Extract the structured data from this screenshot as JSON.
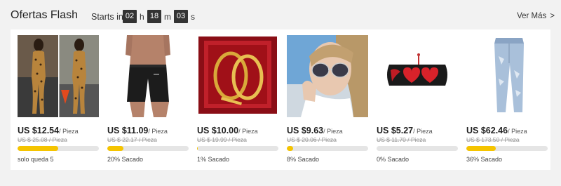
{
  "header": {
    "title": "Ofertas Flash",
    "starts_label": "Starts in",
    "hours": "02",
    "hours_unit": "h",
    "minutes": "18",
    "minutes_unit": "m",
    "seconds": "03",
    "seconds_unit": "s",
    "view_all_label": "Ver Más",
    "chevron": ">"
  },
  "colors": {
    "accent_bar": "#f5c400",
    "bar_track": "#e5e5e5",
    "timer_bg": "#333333"
  },
  "products": [
    {
      "image": "leopard-jumpsuit-image",
      "price": "US $12.54",
      "per_unit": "/ Pieza",
      "old_price": "US $ 25.08 / Pieza",
      "sold_fraction": 0.5,
      "status": "solo queda 5"
    },
    {
      "image": "black-shorts-image",
      "price": "US $11.09",
      "per_unit": "/ Pieza",
      "old_price": "US $ 22.17 / Pieza",
      "sold_fraction": 0.2,
      "status": "20% Sacado"
    },
    {
      "image": "gold-bracelet-image",
      "price": "US $10.00",
      "per_unit": "/ Pieza",
      "old_price": "US $ 19.99 / Pieza",
      "sold_fraction": 0.01,
      "status": "1% Sacado"
    },
    {
      "image": "sunglasses-woman-image",
      "price": "US $9.63",
      "per_unit": "/ Pieza",
      "old_price": "US $ 20.06 / Pieza",
      "sold_fraction": 0.08,
      "status": "8% Sacado"
    },
    {
      "image": "heart-beaded-bracelet-image",
      "price": "US $5.27",
      "per_unit": "/ Pieza",
      "old_price": "US $ 11.70 / Pieza",
      "sold_fraction": 0.0,
      "status": "0% Sacado"
    },
    {
      "image": "ripped-jeans-image",
      "price": "US $62.46",
      "per_unit": "/ Pieza",
      "old_price": "US $ 173.50 / Pieza",
      "sold_fraction": 0.36,
      "status": "36% Sacado"
    }
  ]
}
